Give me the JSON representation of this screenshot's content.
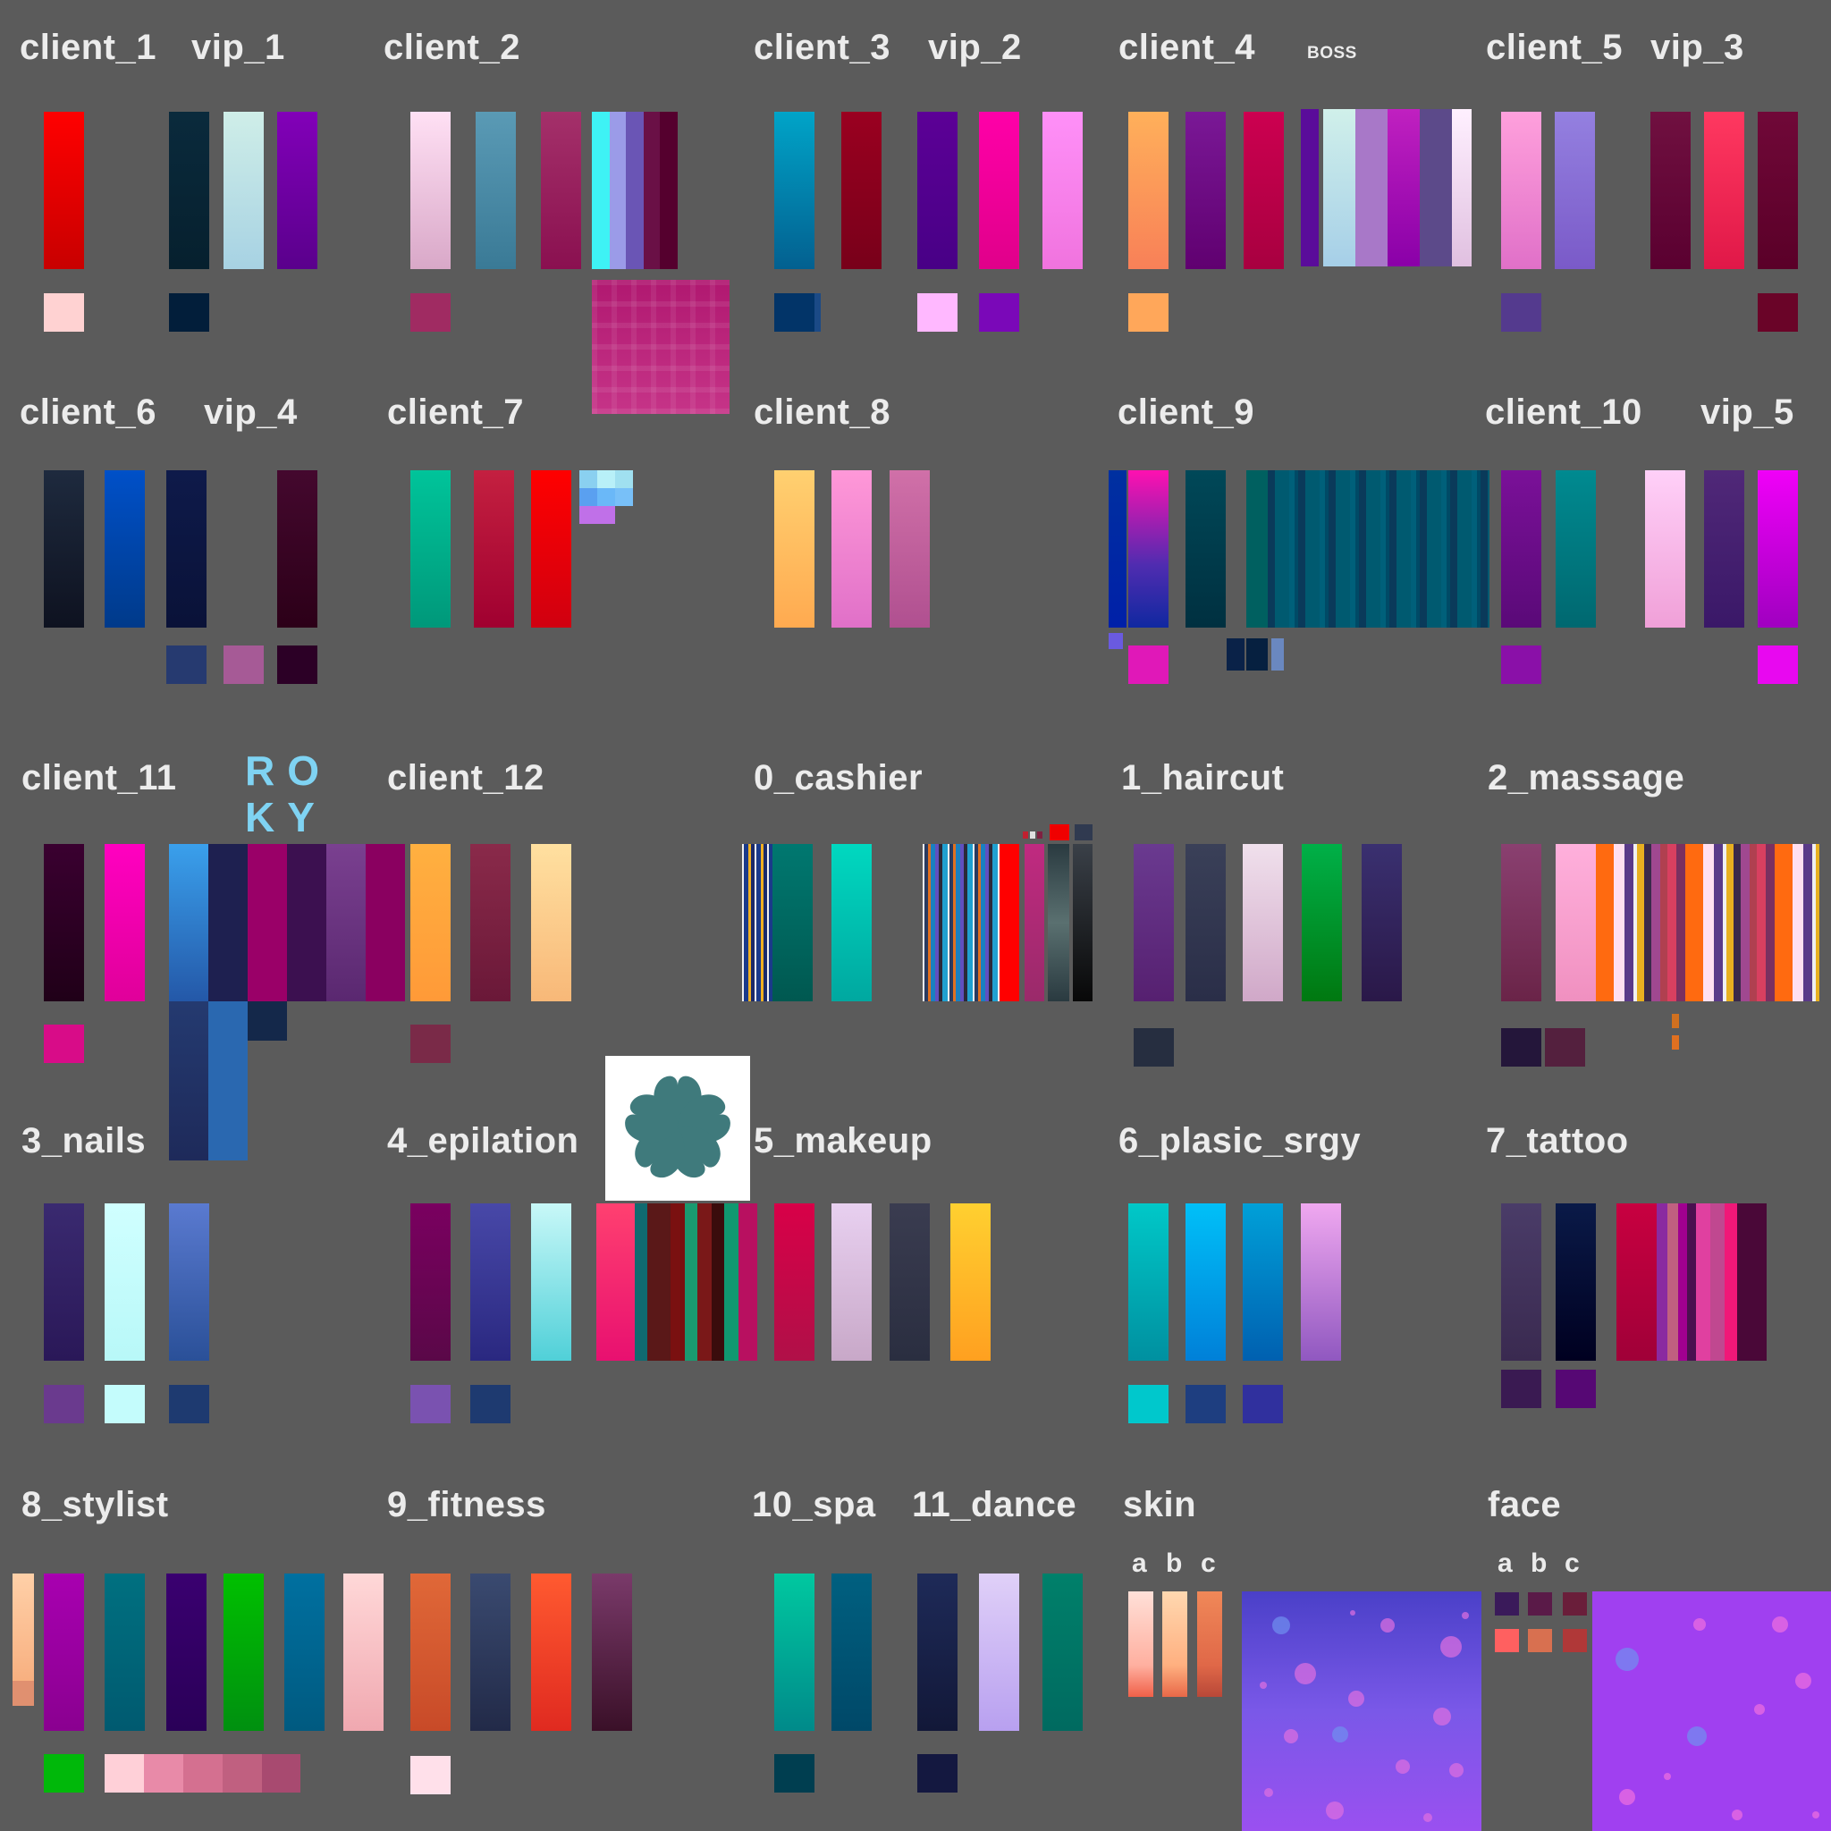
{
  "labels": {
    "client_1": "client_1",
    "vip_1": "vip_1",
    "client_2": "client_2",
    "client_3": "client_3",
    "vip_2": "vip_2",
    "client_4": "client_4",
    "boss": "BOSS",
    "client_5": "client_5",
    "vip_3": "vip_3",
    "client_6": "client_6",
    "vip_4": "vip_4",
    "client_7": "client_7",
    "client_8": "client_8",
    "client_9": "client_9",
    "client_10": "client_10",
    "vip_5": "vip_5",
    "client_11": "client_11",
    "roky_line1": "RO",
    "roky_line2": "KY",
    "client_12": "client_12",
    "cashier": "0_cashier",
    "haircut": "1_haircut",
    "massage": "2_massage",
    "nails": "3_nails",
    "epilation": "4_epilation",
    "makeup": "5_makeup",
    "plastic_surgery": "6_plasic_srgy",
    "tattoo": "7_tattoo",
    "stylist": "8_stylist",
    "fitness": "9_fitness",
    "spa": "10_spa",
    "dance": "11_dance",
    "skin": "skin",
    "face": "face",
    "skin_a": "a",
    "skin_b": "b",
    "skin_c": "c",
    "face_a": "a",
    "face_b": "b",
    "face_c": "c"
  },
  "colors": {
    "background": "#5b5b5b",
    "label_text": "#ececec",
    "roky_text": "#7fd3f3",
    "logo_background": "#ffffff",
    "logo_leaf": "#3f7a7c"
  },
  "icons": {
    "logo": "four-leaf-clover-icon"
  }
}
